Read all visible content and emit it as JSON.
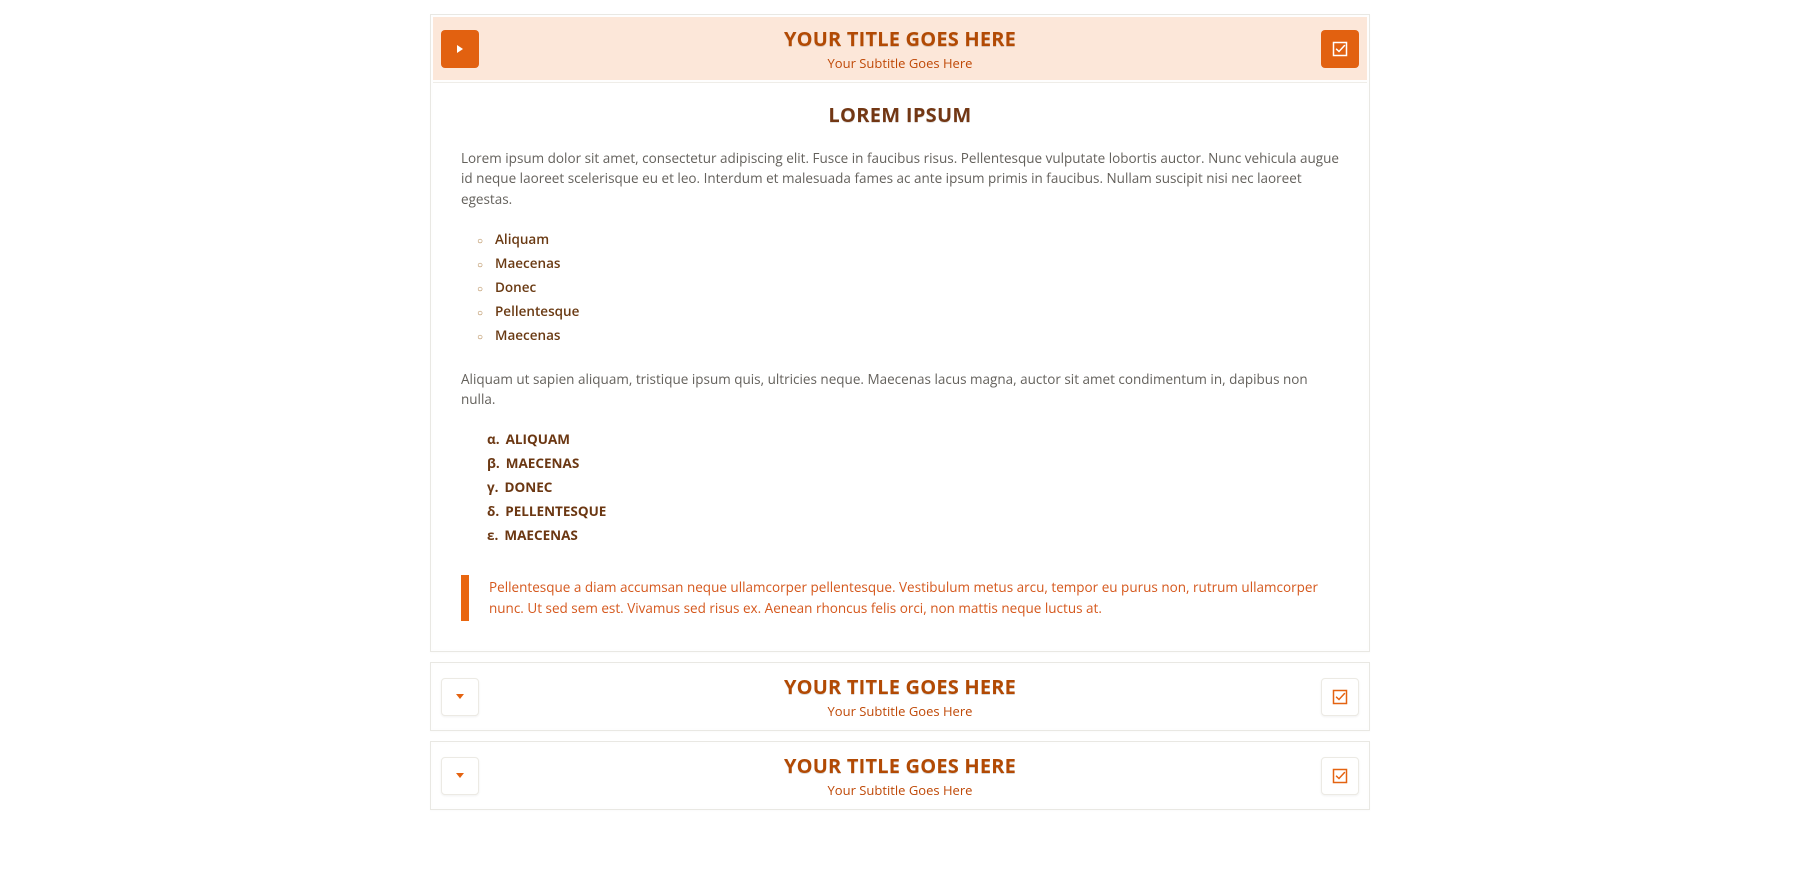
{
  "accent": "#e26110",
  "panels": [
    {
      "title": "YOUR TITLE GOES HERE",
      "subtitle": "Your Subtitle Goes Here",
      "expanded": true
    },
    {
      "title": "YOUR TITLE GOES HERE",
      "subtitle": "Your Subtitle Goes Here",
      "expanded": false
    },
    {
      "title": "YOUR TITLE GOES HERE",
      "subtitle": "Your Subtitle Goes Here",
      "expanded": false
    }
  ],
  "content": {
    "heading": "LOREM IPSUM",
    "para1": "Lorem ipsum dolor sit amet, consectetur adipiscing elit. Fusce in faucibus risus. Pellentesque vulputate lobortis auctor. Nunc vehicula augue id neque laoreet scelerisque eu et leo. Interdum et malesuada fames ac ante ipsum primis in faucibus. Nullam suscipit nisi nec laoreet egestas.",
    "bullets": [
      "Aliquam",
      "Maecenas",
      "Donec",
      "Pellentesque",
      "Maecenas"
    ],
    "para2": "Aliquam ut sapien aliquam, tristique ipsum quis, ultricies neque. Maecenas lacus magna, auctor sit amet condimentum in, dapibus non nulla.",
    "greek_markers": [
      "α.",
      "β.",
      "γ.",
      "δ.",
      "ε."
    ],
    "greek_items": [
      "ALIQUAM",
      "MAECENAS",
      "DONEC",
      "PELLENTESQUE",
      "MAECENAS"
    ],
    "quote": "Pellentesque a diam accumsan neque ullamcorper pellentesque. Vestibulum metus arcu, tempor eu purus non, rutrum ullamcorper nunc. Ut sed sem est. Vivamus sed risus ex. Aenean rhoncus felis orci, non mattis neque luctus at."
  }
}
